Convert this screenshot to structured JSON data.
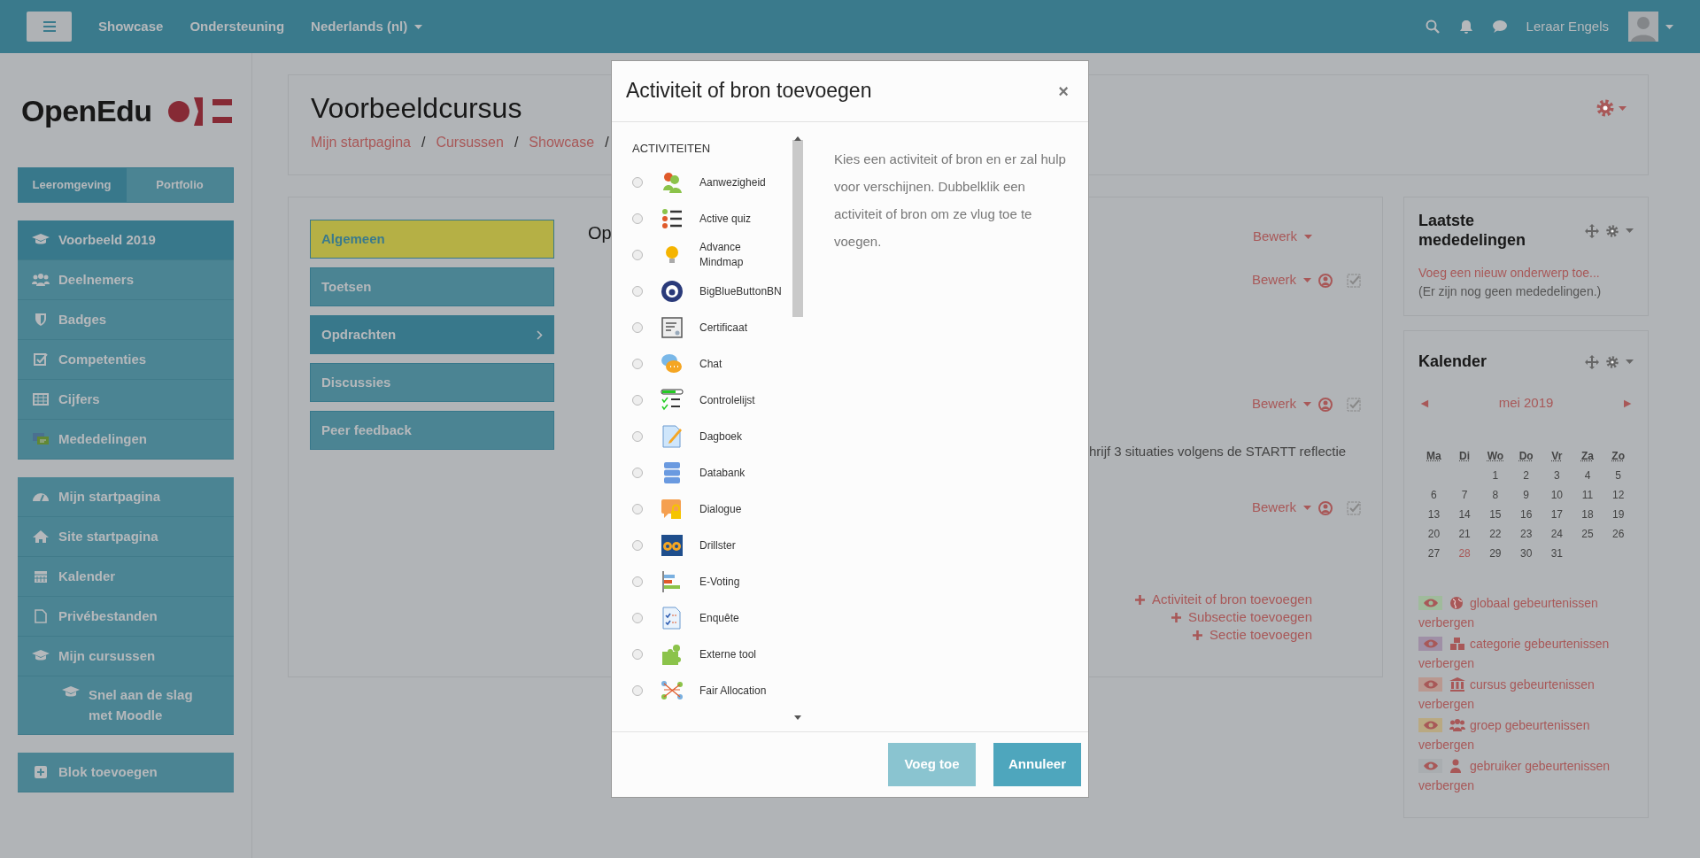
{
  "navbar": {
    "links": [
      {
        "label": "Showcase",
        "dropdown": false
      },
      {
        "label": "Ondersteuning",
        "dropdown": false
      },
      {
        "label": "Nederlands (nl)",
        "dropdown": true
      }
    ],
    "user": "Leraar Engels"
  },
  "sidebar": {
    "logo": "OpenEdu",
    "tabs": [
      {
        "label": "Leeromgeving",
        "selected": true
      },
      {
        "label": "Portfolio",
        "selected": false
      }
    ],
    "groups": [
      [
        {
          "label": "Voorbeeld 2019",
          "selected": true
        },
        {
          "label": "Deelnemers",
          "selected": false
        },
        {
          "label": "Badges",
          "selected": false
        },
        {
          "label": "Competenties",
          "selected": false
        },
        {
          "label": "Cijfers",
          "selected": false
        },
        {
          "label": "Mededelingen",
          "selected": false
        }
      ],
      [
        {
          "label": "Mijn startpagina",
          "selected": false
        },
        {
          "label": "Site startpagina",
          "selected": false
        },
        {
          "label": "Kalender",
          "selected": false
        },
        {
          "label": "Privébestanden",
          "selected": false
        },
        {
          "label": "Mijn cursussen",
          "selected": false,
          "children": [
            {
              "label": "Snel aan de slag met Moodle",
              "selected": false
            }
          ]
        }
      ],
      [
        {
          "label": "Blok toevoegen",
          "selected": false
        }
      ]
    ]
  },
  "course": {
    "title": "Voorbeeldcursus",
    "breadcrumb": [
      "Mijn startpagina",
      "Cursussen",
      "Showcase"
    ],
    "separator": "/",
    "sections": [
      {
        "label": "Algemeen",
        "selected": true,
        "expandable": false
      },
      {
        "label": "Toetsen",
        "selected": false,
        "expandable": false
      },
      {
        "label": "Opdrachten",
        "selected": false,
        "expandable": true
      },
      {
        "label": "Discussies",
        "selected": false,
        "expandable": false
      },
      {
        "label": "Peer feedback",
        "selected": false,
        "expandable": false
      }
    ],
    "section_title": "Op",
    "content": [
      {
        "kind": "edit",
        "label": "Bewerk",
        "extras": false
      },
      {
        "kind": "edit",
        "label": "Bewerk",
        "extras": true
      },
      {
        "kind": "edit",
        "label": "Bewerk",
        "extras": true
      },
      {
        "kind": "text",
        "label": "hrijf 3 situaties volgens de STARTT reflectie"
      },
      {
        "kind": "edit",
        "label": "Bewerk",
        "extras": true
      }
    ],
    "add_links": [
      "Activiteit of bron toevoegen",
      "Subsectie toevoegen",
      "Sectie toevoegen"
    ]
  },
  "blocks": {
    "news": {
      "title": "Laatste mededelingen",
      "link": "Voeg een nieuw onderwerp toe...",
      "note": "(Er zijn nog geen mededelingen.)"
    },
    "calendar": {
      "title": "Kalender",
      "prev": "◄",
      "month": "mei 2019",
      "next": "►",
      "weekdays": [
        "Ma",
        "Di",
        "Wo",
        "Do",
        "Vr",
        "Za",
        "Zo"
      ],
      "weeks": [
        [
          {
            "day": "1",
            "today": false
          },
          {
            "day": "2",
            "today": false
          },
          {
            "day": "3",
            "today": false
          },
          {
            "day": "4",
            "today": false
          },
          {
            "day": "5",
            "today": false
          }
        ],
        [
          {
            "day": "6",
            "today": false
          },
          {
            "day": "7",
            "today": false
          },
          {
            "day": "8",
            "today": false
          },
          {
            "day": "9",
            "today": false
          },
          {
            "day": "10",
            "today": false
          },
          {
            "day": "11",
            "today": false
          },
          {
            "day": "12",
            "today": false
          }
        ],
        [
          {
            "day": "13",
            "today": false
          },
          {
            "day": "14",
            "today": false
          },
          {
            "day": "15",
            "today": false
          },
          {
            "day": "16",
            "today": false
          },
          {
            "day": "17",
            "today": false
          },
          {
            "day": "18",
            "today": false
          },
          {
            "day": "19",
            "today": false
          }
        ],
        [
          {
            "day": "20",
            "today": false
          },
          {
            "day": "21",
            "today": false
          },
          {
            "day": "22",
            "today": false
          },
          {
            "day": "23",
            "today": false
          },
          {
            "day": "24",
            "today": false
          },
          {
            "day": "25",
            "today": false
          },
          {
            "day": "26",
            "today": false
          }
        ],
        [
          {
            "day": "27",
            "today": false
          },
          {
            "day": "28",
            "today": true
          },
          {
            "day": "29",
            "today": false
          },
          {
            "day": "30",
            "today": false
          },
          {
            "day": "31",
            "today": false
          }
        ]
      ],
      "filters": [
        {
          "label": "globaal gebeurtenissen verbergen",
          "color": "#a0bb9c"
        },
        {
          "label": "categorie gebeurtenissen verbergen",
          "color": "#9f8fa6"
        },
        {
          "label": "cursus gebeurtenissen verbergen",
          "color": "#b99890"
        },
        {
          "label": "groep gebeurtenissen verbergen",
          "color": "#b9a982"
        },
        {
          "label": "gebruiker gebeurtenissen verbergen",
          "color": "#a9adb0"
        }
      ]
    }
  },
  "modal": {
    "title": "Activiteit of bron toevoegen",
    "close": "×",
    "heading": "ACTIVITEITEN",
    "items": [
      {
        "label": "Aanwezigheid",
        "selected": false
      },
      {
        "label": "Active quiz",
        "selected": false
      },
      {
        "label": "Advance Mindmap",
        "selected": false
      },
      {
        "label": "BigBlueButtonBN",
        "selected": false
      },
      {
        "label": "Certificaat",
        "selected": false
      },
      {
        "label": "Chat",
        "selected": false
      },
      {
        "label": "Controlelijst",
        "selected": false
      },
      {
        "label": "Dagboek",
        "selected": false
      },
      {
        "label": "Databank",
        "selected": false
      },
      {
        "label": "Dialogue",
        "selected": false
      },
      {
        "label": "Drillster",
        "selected": false
      },
      {
        "label": "E-Voting",
        "selected": false
      },
      {
        "label": "Enquête",
        "selected": false
      },
      {
        "label": "Externe tool",
        "selected": false
      },
      {
        "label": "Fair Allocation",
        "selected": false
      }
    ],
    "help": "Kies een activiteit of bron en er zal hulp voor verschijnen. Dubbelklik een activiteit of bron om ze vlug toe te voegen.",
    "buttons": [
      {
        "label": "Voeg toe",
        "disabled": true
      },
      {
        "label": "Annuleer",
        "disabled": false
      }
    ]
  }
}
